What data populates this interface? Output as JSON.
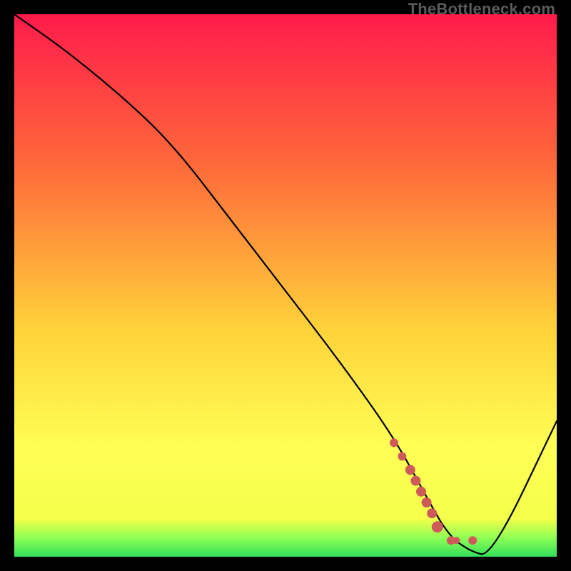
{
  "watermark": "TheBottleneck.com",
  "colors": {
    "bg": "#000000",
    "gradient_top": "#ff1b4b",
    "gradient_mid1": "#ff6a3a",
    "gradient_mid2": "#ffd23a",
    "gradient_low": "#ffff55",
    "gradient_green": "#31e05a",
    "curve_stroke": "#000000",
    "marker_fill": "#cf5a5a"
  },
  "chart_data": {
    "type": "line",
    "title": "",
    "xlabel": "",
    "ylabel": "",
    "xlim": [
      0,
      100
    ],
    "ylim": [
      0,
      100
    ],
    "series": [
      {
        "name": "curve",
        "x": [
          0,
          10,
          22,
          30,
          40,
          50,
          60,
          70,
          76,
          80,
          84,
          88,
          100
        ],
        "y": [
          100,
          93,
          83,
          75,
          62,
          49,
          36,
          22,
          11,
          4,
          1,
          0,
          25
        ]
      }
    ],
    "markers": {
      "name": "highlight-dots",
      "x": [
        70.0,
        71.5,
        73.0,
        74.0,
        75.0,
        76.0,
        77.0,
        78.0,
        80.5,
        81.5,
        84.5
      ],
      "y": [
        21.0,
        18.5,
        16.0,
        14.0,
        12.0,
        10.0,
        8.0,
        5.5,
        3.0,
        3.0,
        3.0
      ],
      "radius": [
        6,
        6,
        7,
        7,
        7,
        7,
        7,
        8,
        6,
        5,
        6
      ]
    }
  }
}
